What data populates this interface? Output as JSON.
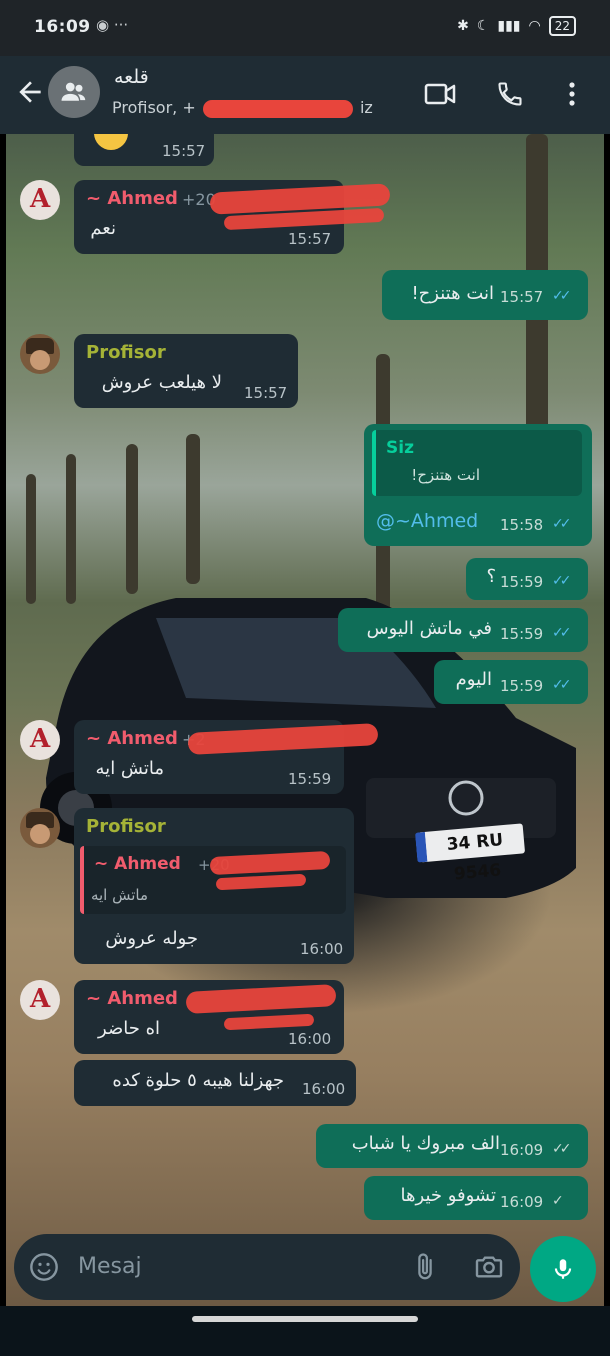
{
  "status": {
    "time": "16:09",
    "battery": "22"
  },
  "header": {
    "title": "قلعه",
    "subtitle": "Profisor, +",
    "subtitle_end": "iz"
  },
  "messages": {
    "m1_time": "15:57",
    "m2_sender": "~ Ahmed",
    "m2_phone": "+20",
    "m2_text": "نعم",
    "m2_time": "15:57",
    "m3_text": "انت هتنزح!",
    "m3_time": "15:57",
    "m4_sender": "Profisor",
    "m4_text": "لا هيلعب عروش",
    "m4_time": "15:57",
    "m5_quote_sender": "Siz",
    "m5_quote_text": "انت هتنزح!",
    "m5_text": "@~Ahmed",
    "m5_time": "15:58",
    "m6_text": "؟",
    "m6_time": "15:59",
    "m7_text": "في ماتش اليوس",
    "m7_time": "15:59",
    "m8_text": "اليوم",
    "m8_time": "15:59",
    "m9_sender": "~ Ahmed",
    "m9_phone": "+2",
    "m9_text": "ماتش ايه",
    "m9_time": "15:59",
    "m10_sender": "Profisor",
    "m10_quote_sender": "~ Ahmed",
    "m10_quote_phone": "+20",
    "m10_quote_text": "ماتش ايه",
    "m10_text": "جوله عروش",
    "m10_time": "16:00",
    "m11_sender": "~ Ahmed",
    "m11_text": "اه حاضر",
    "m11_time": "16:00",
    "m12_text": "جهزلنا هيبه ٥ حلوة كده",
    "m12_time": "16:00",
    "m13_text": "الف مبروك يا شباب",
    "m13_time": "16:09",
    "m14_text": "تشوفو خيرها",
    "m14_time": "16:09"
  },
  "plate": "34 RU 9546",
  "input": {
    "placeholder": "Mesaj"
  },
  "colors": {
    "header": "#1f2c34",
    "incoming": "#1f2c34",
    "outgoing": "#0f6e58",
    "accent": "#00a884",
    "ahmed": "#f15c6d",
    "profisor": "#a5b337",
    "read_ticks": "#53bdeb"
  },
  "icons": [
    "back-arrow-icon",
    "group-avatar-icon",
    "video-call-icon",
    "phone-icon",
    "more-vert-icon",
    "emoji-icon",
    "attach-icon",
    "camera-icon",
    "mic-icon"
  ]
}
